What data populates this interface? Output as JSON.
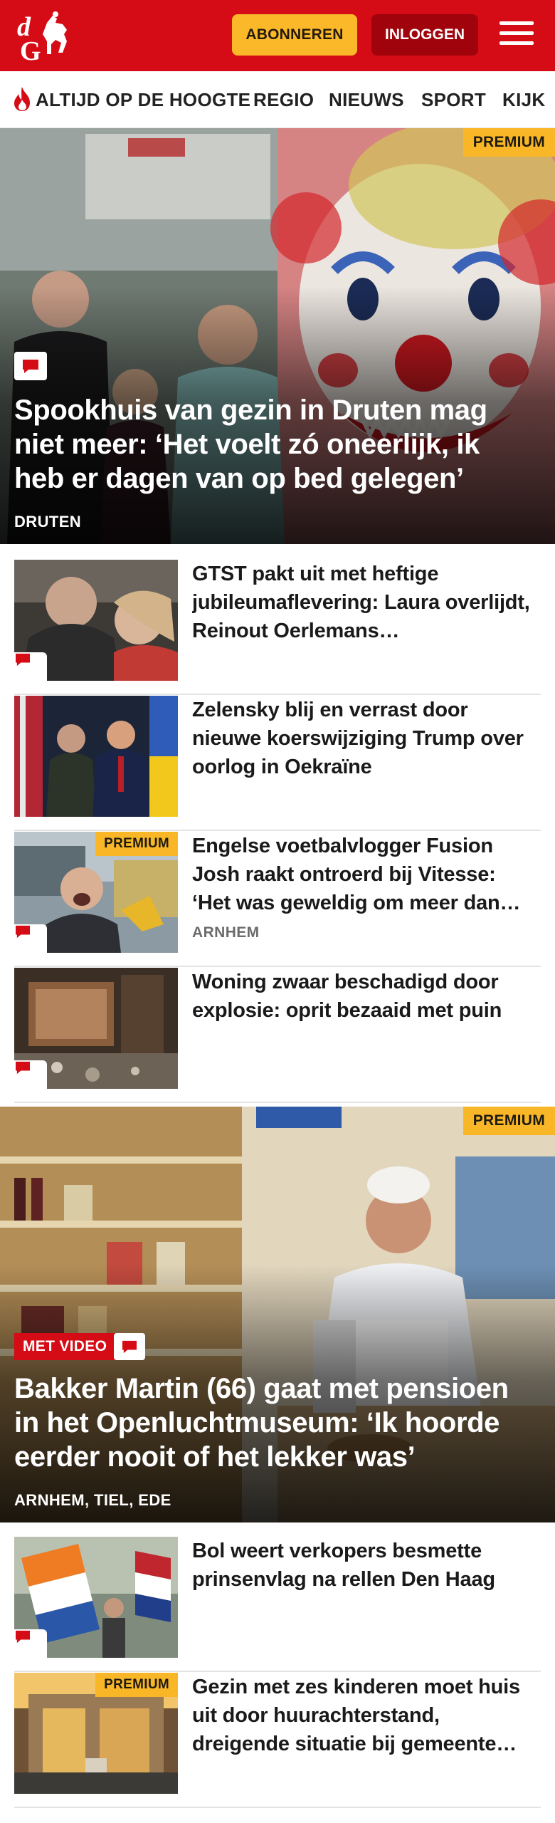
{
  "header": {
    "logo_text": "dG",
    "subscribe_label": "ABONNEREN",
    "login_label": "INLOGGEN",
    "menu_icon": "hamburger-icon",
    "brand_color": "#d50c15"
  },
  "nav": {
    "items": [
      {
        "label": "ALTIJD OP DE HOOGTE",
        "icon": "flame-icon"
      },
      {
        "label": "REGIO"
      },
      {
        "label": "NIEUWS"
      },
      {
        "label": "SPORT"
      },
      {
        "label": "KIJK"
      }
    ]
  },
  "hero1": {
    "badge": "PREMIUM",
    "title": "Spookhuis van gezin in Druten mag niet meer: ‘Het voelt zó oneerlijk, ik heb er dagen van op bed gelegen’",
    "location": "DRUTEN",
    "has_comments": true
  },
  "articles": [
    {
      "title": "GTST pakt uit met heftige jubileumaflevering: Laura overlijdt, Reinout Oerlemans…",
      "location": "",
      "premium": false
    },
    {
      "title": "Zelensky blij en verrast door nieuwe koerswijziging Trump over oorlog in Oekraïne",
      "location": "",
      "premium": false
    },
    {
      "title": "Engelse voetbalvlogger Fusion Josh raakt ontroerd bij Vitesse: ‘Het was geweldig om meer dan…",
      "location": "ARNHEM",
      "premium": true,
      "badge": "PREMIUM"
    },
    {
      "title": "Woning zwaar beschadigd door explosie: oprit bezaaid met puin",
      "location": "",
      "premium": false
    }
  ],
  "hero2": {
    "badge": "PREMIUM",
    "video_label": "MET VIDEO",
    "title": "Bakker Martin (66) gaat met pensioen in het Openluchtmuseum: ‘Ik hoorde eerder nooit of het lekker was’",
    "location": "ARNHEM, TIEL, EDE",
    "has_comments": true
  },
  "articles2": [
    {
      "title": "Bol weert verkopers besmette prinsenvlag na rellen Den Haag",
      "location": "",
      "premium": false
    },
    {
      "title": "Gezin met zes kinderen moet huis uit door huurachterstand, dreigende situatie bij gemeente…",
      "location": "",
      "premium": true,
      "badge": "PREMIUM"
    }
  ],
  "colors": {
    "accent": "#d50c15",
    "subscribe": "#fbb92a",
    "login": "#a0030c",
    "premium": "#f9b727"
  }
}
